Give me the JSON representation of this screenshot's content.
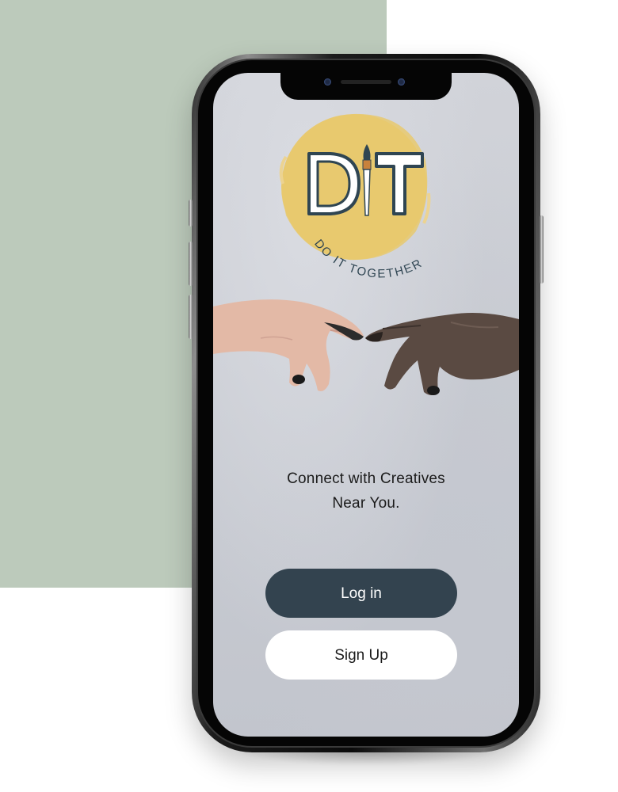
{
  "logo": {
    "letters": "DIT",
    "tagline": "DO IT TOGETHER"
  },
  "screen": {
    "tagline_line1": "Connect with Creatives",
    "tagline_line2": "Near You."
  },
  "buttons": {
    "login_label": "Log in",
    "signup_label": "Sign Up"
  },
  "colors": {
    "background_block": "#bccabb",
    "logo_circle": "#e8c96f",
    "logo_ink": "#2f4552",
    "login_button": "#33434f",
    "signup_button": "#ffffff"
  },
  "icons": [
    "paintbrush-icon",
    "reaching-hands-illustration"
  ]
}
